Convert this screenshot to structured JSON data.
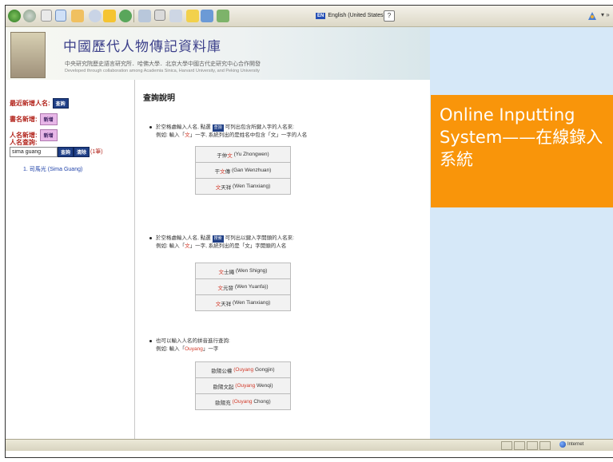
{
  "browser": {
    "language_indicator": {
      "code": "EN",
      "text": "English (United States)"
    },
    "help_icon": "?"
  },
  "banner": {
    "title": "中國歷代人物傳記資料庫",
    "subtitle_cn": "中央研究院歷史語言研究所．哈佛大學．北京大學中國古代史研究中心合作開發",
    "subtitle_en": "Developed through collaboration among Academia Sinica, Harvard University, and Peking University"
  },
  "sidebar": {
    "recent_person_label": "最近新增人名:",
    "recent_person_btn": "查詢",
    "book_add_label": "書名新增:",
    "book_add_btn": "新增",
    "person_add_label": "人名新增:",
    "person_add_btn": "新增",
    "person_query_label": "人名查詢:",
    "search_value": "sima guang",
    "query_btn": "查詢",
    "clear_btn": "清除",
    "result_count": "(1筆)",
    "results": [
      {
        "index": "1.",
        "name_cn": "司馬光",
        "name_en": "(Sima Guang)"
      }
    ]
  },
  "main": {
    "heading": "查詢說明",
    "section1": {
      "line1_before": "於空格處輸入人名, 點選",
      "button": "查詢",
      "line1_after": "可列出包含所鍵入字的人名來:",
      "line2_before": "例如: 輸入「",
      "line2_key": "文",
      "line2_after": "」一字, 系統列出的是姓名中包含「文」一字的人名",
      "examples": [
        {
          "pre": "于仲",
          "hl": "文",
          "post": "",
          "en": "(Yu Zhongwen)"
        },
        {
          "pre": "干",
          "hl": "文",
          "post": "傳",
          "en": "(Gan Wenzhuan)"
        },
        {
          "pre": "",
          "hl": "文",
          "post": "天祥",
          "en": "(Wen Tianxiang)"
        }
      ]
    },
    "section2": {
      "line1_before": "於空格處輸入人名, 點選",
      "button": "搜索",
      "line1_after": "可列出以鍵入字開頭的人名來:",
      "line2_before": "例如: 輸入「",
      "line2_key": "文",
      "line2_after": "」一字, 系統列出的是「文」字開頭的人名",
      "examples": [
        {
          "pre": "",
          "hl": "文",
          "post": "士繩",
          "en": "(Wen Shigng)"
        },
        {
          "pre": "",
          "hl": "文",
          "post": "元發",
          "en": "(Wen Yuanfa))"
        },
        {
          "pre": "",
          "hl": "文",
          "post": "天祥",
          "en": "(Wen Tianxiang)"
        }
      ]
    },
    "section3": {
      "line1": "也可以輸入人名的拼音進行查詢:",
      "line2_before": "例如: 輸入「",
      "line2_key": "Ouyang",
      "line2_after": "」一字",
      "examples": [
        {
          "cn": "歐陽公權",
          "hl": "(Ouyang",
          "en": "Gongjin)"
        },
        {
          "cn": "歐陽文起",
          "hl": "(Ouyang",
          "en": "Wenqi)"
        },
        {
          "cn": "歐陽充",
          "hl": "(Ouyang",
          "en": "Chong)"
        }
      ]
    }
  },
  "callout": {
    "text": "Online Inputting System——在線錄入系統"
  },
  "statusbar": {
    "zone": "Internet"
  }
}
